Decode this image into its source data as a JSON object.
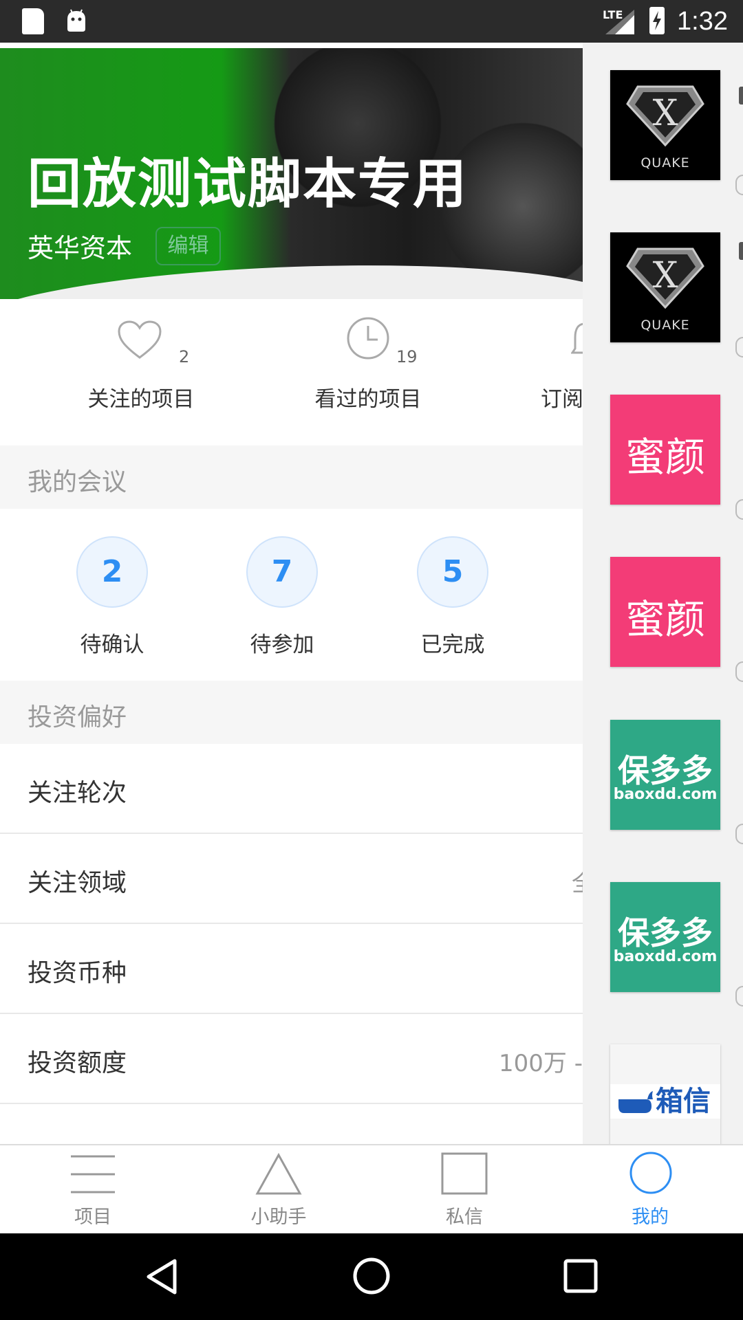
{
  "status_bar": {
    "time": "1:32",
    "network": "LTE"
  },
  "banner": {
    "title": "回放测试脚本专用",
    "company": "英华资本",
    "edit_label": "编辑"
  },
  "stats": [
    {
      "label": "关注的项目",
      "count": "2",
      "icon": "heart-icon"
    },
    {
      "label": "看过的项目",
      "count": "19",
      "icon": "clock-icon"
    },
    {
      "label": "订阅",
      "count": "",
      "icon": "bell-icon"
    }
  ],
  "meetings": {
    "header": "我的会议",
    "items": [
      {
        "count": "2",
        "label": "待确认"
      },
      {
        "count": "7",
        "label": "待参加"
      },
      {
        "count": "5",
        "label": "已完成"
      }
    ],
    "accent_color": "#2d8ef3"
  },
  "preferences": {
    "header": "投资偏好",
    "rows": [
      {
        "label": "关注轮次",
        "value": ""
      },
      {
        "label": "关注领域",
        "value": "全"
      },
      {
        "label": "投资币种",
        "value": ""
      },
      {
        "label": "投资额度",
        "value": "100万 -"
      }
    ]
  },
  "drawer": {
    "items": [
      {
        "brand": "QUAKE",
        "type": "quake"
      },
      {
        "brand": "QUAKE",
        "type": "quake"
      },
      {
        "brand": "蜜颜",
        "type": "miyan"
      },
      {
        "brand": "蜜颜",
        "type": "miyan"
      },
      {
        "brand": "保多多",
        "sub": "baoxdd.com",
        "type": "baoduo"
      },
      {
        "brand": "保多多",
        "sub": "baoxdd.com",
        "type": "baoduo"
      },
      {
        "brand": "箱信",
        "type": "xiangxin"
      }
    ]
  },
  "tabs": [
    {
      "label": "项目",
      "icon": "menu-lines-icon",
      "active": false
    },
    {
      "label": "小助手",
      "icon": "triangle-icon",
      "active": false
    },
    {
      "label": "私信",
      "icon": "square-icon",
      "active": false
    },
    {
      "label": "我的",
      "icon": "circle-icon",
      "active": true
    }
  ],
  "colors": {
    "accent": "#2d8ef3",
    "banner_green": "#159a15"
  }
}
